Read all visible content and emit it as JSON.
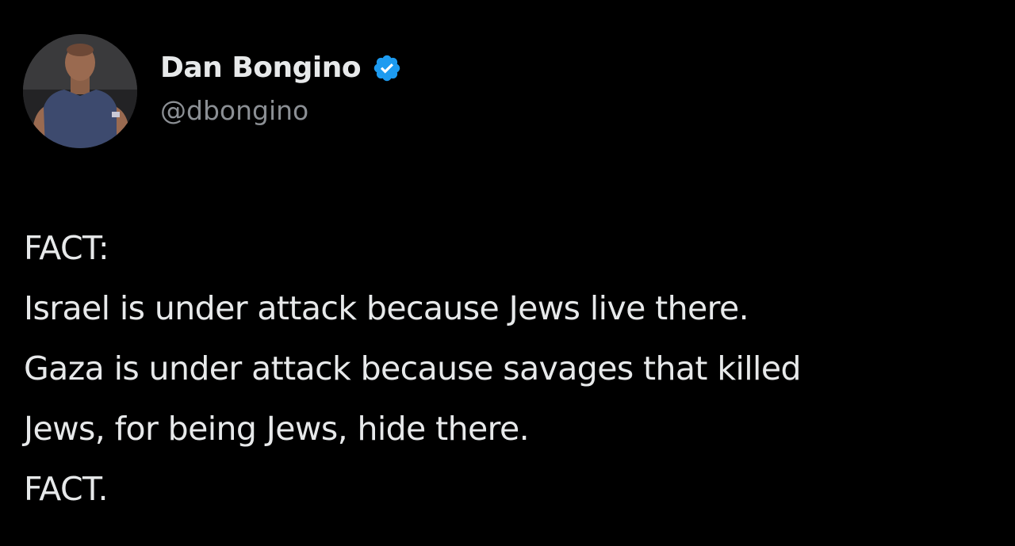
{
  "author": {
    "display_name": "Dan Bongino",
    "handle": "@dbongino",
    "verified": true,
    "verified_color": "#1d9bf0",
    "avatar_icon": "profile-photo"
  },
  "tweet": {
    "lines": [
      "FACT:",
      "Israel is under attack because Jews live there.",
      "Gaza is under attack because savages that killed",
      "Jews, for being Jews, hide there.",
      "FACT."
    ]
  },
  "colors": {
    "background": "#000000",
    "primary_text": "#e7e9ea",
    "secondary_text": "#8b8f94"
  }
}
